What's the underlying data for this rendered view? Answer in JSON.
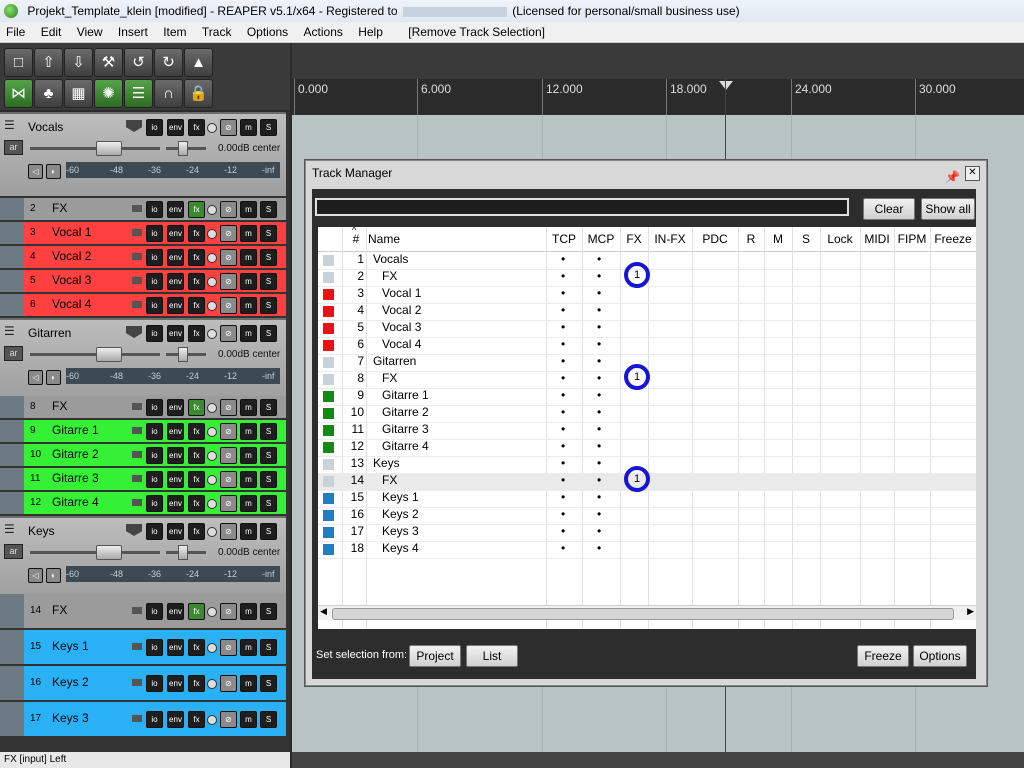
{
  "window": {
    "title_prefix": "Projekt_Template_klein [modified] - REAPER v5.1/x64 - Registered to",
    "title_suffix": "(Licensed for personal/small business use)"
  },
  "menu": [
    "File",
    "Edit",
    "View",
    "Insert",
    "Item",
    "Track",
    "Options",
    "Actions",
    "Help",
    "[Remove Track Selection]"
  ],
  "status_text": "FX [input] Left",
  "ruler": [
    "0.000",
    "6.000",
    "12.000",
    "18.000",
    "24.000",
    "30.000"
  ],
  "tcp": {
    "meter_ticks": [
      "-60",
      "-48",
      "-36",
      "-24",
      "-12",
      "-inf"
    ],
    "db_label": "0.00dB center",
    "btn_io": "io",
    "btn_env": "env",
    "btn_fx": "fx",
    "btn_m": "m",
    "btn_s": "S",
    "btn_ar": "ar",
    "folders": [
      {
        "name": "Vocals"
      },
      {
        "name": "Gitarren"
      },
      {
        "name": "Keys"
      }
    ],
    "children": [
      {
        "num": "2",
        "name": "FX"
      },
      {
        "num": "3",
        "name": "Vocal 1"
      },
      {
        "num": "4",
        "name": "Vocal 2"
      },
      {
        "num": "5",
        "name": "Vocal 3"
      },
      {
        "num": "6",
        "name": "Vocal 4"
      },
      {
        "num": "8",
        "name": "FX"
      },
      {
        "num": "9",
        "name": "Gitarre 1"
      },
      {
        "num": "10",
        "name": "Gitarre 2"
      },
      {
        "num": "11",
        "name": "Gitarre 3"
      },
      {
        "num": "12",
        "name": "Gitarre 4"
      },
      {
        "num": "14",
        "name": "FX"
      },
      {
        "num": "15",
        "name": "Keys 1"
      },
      {
        "num": "16",
        "name": "Keys 2"
      },
      {
        "num": "17",
        "name": "Keys 3"
      }
    ]
  },
  "track_manager": {
    "title": "Track Manager",
    "filter_value": "",
    "clear_label": "Clear",
    "show_all_label": "Show all",
    "columns": [
      "#",
      "Name",
      "TCP",
      "MCP",
      "FX",
      "IN-FX",
      "PDC",
      "R",
      "M",
      "S",
      "Lock",
      "MIDI",
      "FIPM",
      "Freeze"
    ],
    "rows": [
      {
        "num": "1",
        "name": "Vocals",
        "indent": false,
        "color": "#c8d2d8",
        "fx": ""
      },
      {
        "num": "2",
        "name": "FX",
        "indent": true,
        "color": "#c8d2d8",
        "fx": "1"
      },
      {
        "num": "3",
        "name": "Vocal 1",
        "indent": true,
        "color": "#ee1111",
        "fx": ""
      },
      {
        "num": "4",
        "name": "Vocal 2",
        "indent": true,
        "color": "#ee1111",
        "fx": ""
      },
      {
        "num": "5",
        "name": "Vocal 3",
        "indent": true,
        "color": "#ee1111",
        "fx": ""
      },
      {
        "num": "6",
        "name": "Vocal 4",
        "indent": true,
        "color": "#ee1111",
        "fx": ""
      },
      {
        "num": "7",
        "name": "Gitarren",
        "indent": false,
        "color": "#c8d2d8",
        "fx": ""
      },
      {
        "num": "8",
        "name": "FX",
        "indent": true,
        "color": "#c8d2d8",
        "fx": "1"
      },
      {
        "num": "9",
        "name": "Gitarre 1",
        "indent": true,
        "color": "#138a13",
        "fx": ""
      },
      {
        "num": "10",
        "name": "Gitarre 2",
        "indent": true,
        "color": "#138a13",
        "fx": ""
      },
      {
        "num": "11",
        "name": "Gitarre 3",
        "indent": true,
        "color": "#138a13",
        "fx": ""
      },
      {
        "num": "12",
        "name": "Gitarre 4",
        "indent": true,
        "color": "#138a13",
        "fx": ""
      },
      {
        "num": "13",
        "name": "Keys",
        "indent": false,
        "color": "#c8d2d8",
        "fx": ""
      },
      {
        "num": "14",
        "name": "FX",
        "indent": true,
        "color": "#c8d2d8",
        "fx": "1"
      },
      {
        "num": "15",
        "name": "Keys 1",
        "indent": true,
        "color": "#1f7fc0",
        "fx": ""
      },
      {
        "num": "16",
        "name": "Keys 2",
        "indent": true,
        "color": "#1f7fc0",
        "fx": ""
      },
      {
        "num": "17",
        "name": "Keys 3",
        "indent": true,
        "color": "#1f7fc0",
        "fx": ""
      },
      {
        "num": "18",
        "name": "Keys 4",
        "indent": true,
        "color": "#1f7fc0",
        "fx": ""
      }
    ],
    "set_selection_label": "Set selection from:",
    "project_label": "Project",
    "list_label": "List",
    "freeze_label": "Freeze",
    "options_label": "Options"
  },
  "colors": {
    "vocal": "#ff4040",
    "guitar": "#36f036",
    "keys": "#29b0f5",
    "fx_circle": "#1515d6"
  }
}
